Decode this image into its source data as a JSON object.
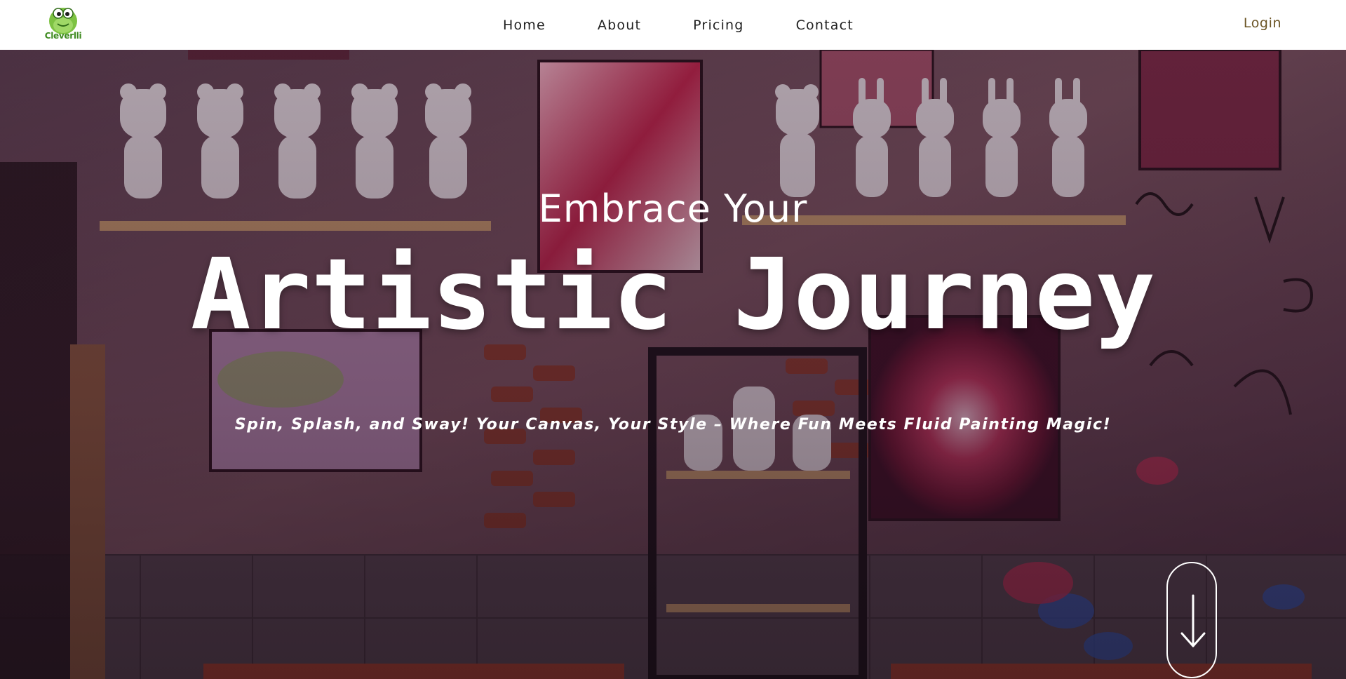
{
  "brand": {
    "logo_text": "Cleverlli",
    "logo_icon": "frog-mascot-logo",
    "logo_color": "#3d8a1f"
  },
  "nav": {
    "items": [
      {
        "label": "Home"
      },
      {
        "label": "About"
      },
      {
        "label": "Pricing"
      },
      {
        "label": "Contact"
      }
    ],
    "login_label": "Login",
    "login_color": "#6b5424"
  },
  "hero": {
    "pretitle": "Embrace Your",
    "title": "Artistic Journey",
    "subtitle": "Spin, Splash, and Sway! Your Canvas, Your Style – Where Fun Meets Fluid Painting Magic!",
    "background_description_icon": "art-studio-wall-photo",
    "scroll_icon": "arrow-down-icon"
  }
}
